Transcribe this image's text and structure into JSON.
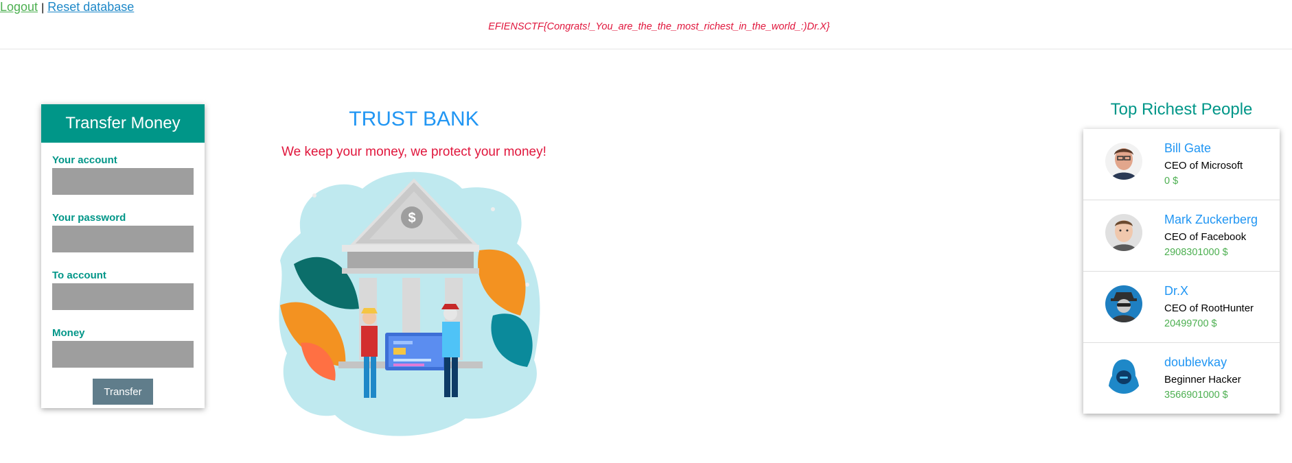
{
  "nav": {
    "logout_label": "Logout",
    "separator": "|",
    "reset_label": "Reset database"
  },
  "flag_text": "EFIENSCTF{Congrats!_You_are_the_the_most_richest_in_the_world_:)Dr.X}",
  "transfer": {
    "header": "Transfer Money",
    "your_account_label": "Your account",
    "your_account_value": "",
    "your_password_label": "Your password",
    "your_password_value": "",
    "to_account_label": "To account",
    "to_account_value": "",
    "money_label": "Money",
    "money_value": "",
    "button_label": "Transfer"
  },
  "bank": {
    "title": "TRUST BANK",
    "slogan": "We keep your money, we protect your money!",
    "illustration_symbol": "$"
  },
  "richest": {
    "title": "Top Richest People",
    "people": [
      {
        "name": "Bill Gate",
        "title": "CEO of Microsoft",
        "money": "0 $",
        "avatar_icon": "bill-gate-avatar"
      },
      {
        "name": "Mark Zuckerberg",
        "title": "CEO of Facebook",
        "money": "2908301000 $",
        "avatar_icon": "mark-zuckerberg-avatar"
      },
      {
        "name": "Dr.X",
        "title": "CEO of RootHunter",
        "money": "20499700 $",
        "avatar_icon": "spy-avatar"
      },
      {
        "name": "doublevkay",
        "title": "Beginner Hacker",
        "money": "3566901000 $",
        "avatar_icon": "hooded-hacker-avatar"
      }
    ]
  },
  "colors": {
    "teal": "#009688",
    "blue": "#2196f3",
    "red": "#e0163c",
    "green": "#4caf50",
    "input_gray": "#9e9e9e",
    "button_gray": "#607d8b"
  }
}
